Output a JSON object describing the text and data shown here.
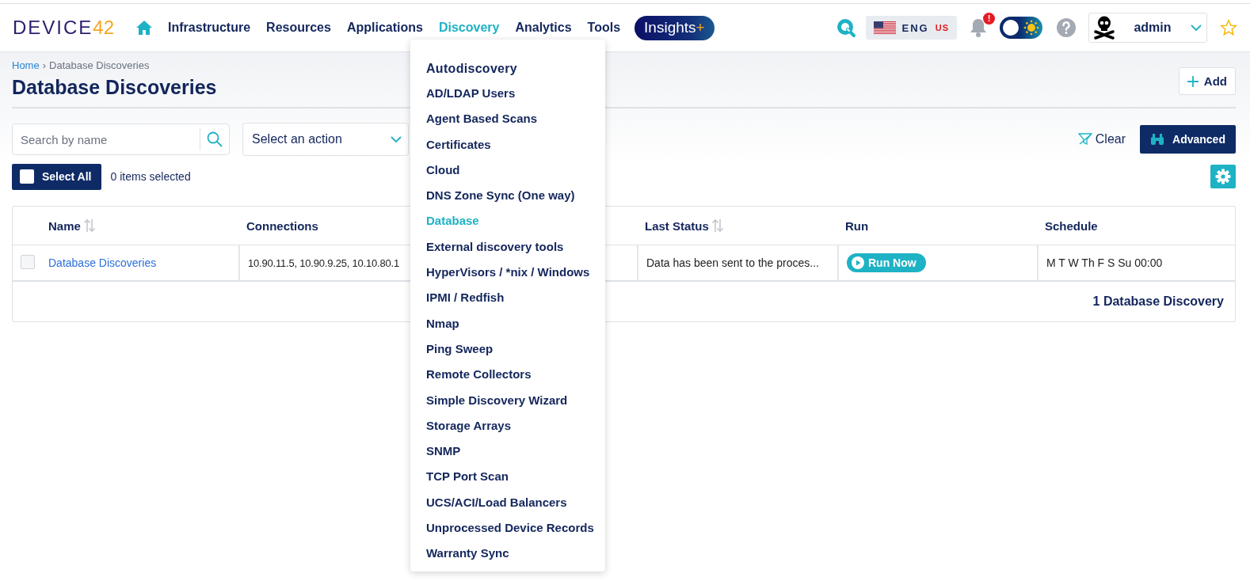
{
  "logo": {
    "text": "DEVICE",
    "accent": "42"
  },
  "nav": [
    {
      "label": "Infrastructure",
      "selected": false
    },
    {
      "label": "Resources",
      "selected": false
    },
    {
      "label": "Applications",
      "selected": false
    },
    {
      "label": "Discovery",
      "selected": true
    },
    {
      "label": "Analytics",
      "selected": false
    },
    {
      "label": "Tools",
      "selected": false
    }
  ],
  "insights": {
    "label": "Insights",
    "accent": "+"
  },
  "language": {
    "code": "ENG",
    "region": "US"
  },
  "notifications": {
    "badge": "!"
  },
  "theme_toggle": {
    "dark_mode": false
  },
  "user": {
    "name": "admin"
  },
  "favorite": {
    "starred": false
  },
  "breadcrumb": {
    "items": [
      {
        "label": "Home",
        "kind": "link"
      },
      {
        "label": "Database Discoveries",
        "kind": "current"
      }
    ],
    "separator": "›"
  },
  "page_title": "Database Discoveries",
  "add_button": "Add",
  "search": {
    "placeholder": "Search by name"
  },
  "action_select": {
    "value": "Select an action"
  },
  "clear_button": "Clear",
  "advanced_button": "Advanced",
  "select_all": {
    "label": "Select All",
    "checked": false
  },
  "selection_count": "0 items selected",
  "table": {
    "columns": [
      {
        "label": "Name",
        "sortable": true
      },
      {
        "label": "Connections",
        "sortable": false
      },
      {
        "label": "Last Status",
        "sortable": true
      },
      {
        "label": "Run",
        "sortable": false
      },
      {
        "label": "Schedule",
        "sortable": false
      }
    ],
    "rows": [
      {
        "selected": false,
        "name": "Database Discoveries",
        "connections": "10.90.11.5, 10.90.9.25, 10.10.80.1",
        "last_status": "Data has been sent to the proces...",
        "run": "Run Now",
        "schedule": "M T W Th F S Su 00:00"
      }
    ],
    "footer": "1 Database Discovery"
  },
  "menu": {
    "heading": "Autodiscovery",
    "items": [
      {
        "label": "AD/LDAP Users",
        "selected": false
      },
      {
        "label": "Agent Based Scans",
        "selected": false
      },
      {
        "label": "Certificates",
        "selected": false
      },
      {
        "label": "Cloud",
        "selected": false
      },
      {
        "label": "DNS Zone Sync (One way)",
        "selected": false
      },
      {
        "label": "Database",
        "selected": true
      },
      {
        "label": "External discovery tools",
        "selected": false
      },
      {
        "label": "HyperVisors / *nix / Windows",
        "selected": false
      },
      {
        "label": "IPMI / Redfish",
        "selected": false
      },
      {
        "label": "Nmap",
        "selected": false
      },
      {
        "label": "Ping Sweep",
        "selected": false
      },
      {
        "label": "Remote Collectors",
        "selected": false
      },
      {
        "label": "Simple Discovery Wizard",
        "selected": false
      },
      {
        "label": "Storage Arrays",
        "selected": false
      },
      {
        "label": "SNMP",
        "selected": false
      },
      {
        "label": "TCP Port Scan",
        "selected": false
      },
      {
        "label": "UCS/ACI/Load Balancers",
        "selected": false
      },
      {
        "label": "Unprocessed Device Records",
        "selected": false
      },
      {
        "label": "Warranty Sync",
        "selected": false
      }
    ]
  }
}
